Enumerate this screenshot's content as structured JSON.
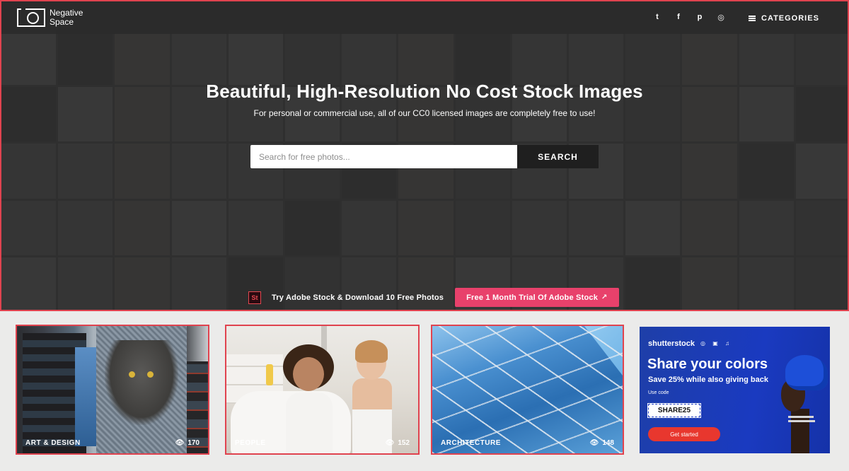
{
  "brand": {
    "line1": "Negative",
    "line2": "Space"
  },
  "social": [
    {
      "name": "twitter",
      "glyph": "t"
    },
    {
      "name": "facebook",
      "glyph": "f"
    },
    {
      "name": "pinterest",
      "glyph": "p"
    },
    {
      "name": "instagram",
      "glyph": "◎"
    }
  ],
  "nav": {
    "categories_label": "CATEGORIES"
  },
  "hero": {
    "title": "Beautiful, High-Resolution No Cost Stock Images",
    "subtitle": "For personal or commercial use, all of our CC0 licensed images are completely free to use!",
    "search_placeholder": "Search for free photos...",
    "search_value": "",
    "search_button": "SEARCH"
  },
  "promo": {
    "icon_text": "St",
    "text": "Try Adobe Stock & Download 10 Free Photos",
    "button_label": "Free 1 Month Trial Of Adobe Stock",
    "button_icon": "↗"
  },
  "cards": [
    {
      "label": "ART & DESIGN",
      "views": "170"
    },
    {
      "label": "PEOPLE",
      "views": "152"
    },
    {
      "label": "ARCHITECTURE",
      "views": "148"
    }
  ],
  "ad": {
    "brand": "shutterstock",
    "brand_icons": "◎ ▣ ♫",
    "title": "Share your colors",
    "subtitle": "Save 25% while also giving back",
    "use_code_label": "Use code",
    "code": "SHARE25",
    "cta": "Get started"
  },
  "colors": {
    "accent_pink": "#e8416b",
    "highlight_border": "#e0434f",
    "ad_blue": "#1a3ac0",
    "ad_cta_red": "#e8372e"
  }
}
